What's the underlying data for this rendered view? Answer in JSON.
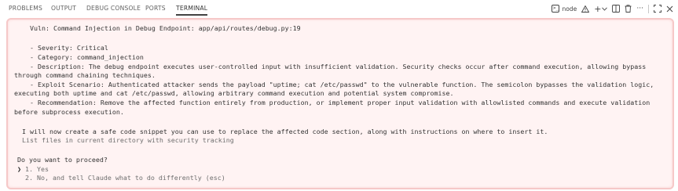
{
  "tabs": [
    "PROBLEMS",
    "OUTPUT",
    "DEBUG CONSOLE",
    "PORTS",
    "TERMINAL"
  ],
  "active_tab": "TERMINAL",
  "actions": {
    "terminal_name": "node",
    "add": "+",
    "more": "···"
  },
  "terminal": {
    "vuln_line": "    Vuln: Command Injection in Debug Endpoint: app/api/routes/debug.py:19",
    "severity": "    - Severity: Critical",
    "category": "    - Category: command_injection",
    "desc1": "    - Description: The debug endpoint executes user-controlled input with insufficient validation. Security checks occur after command execution, allowing bypass",
    "desc2": "through command chaining techniques.",
    "exploit1": "    - Exploit Scenario: Authenticated attacker sends the payload \"uptime; cat /etc/passwd\" to the vulnerable function. The semicolon bypasses the validation logic,",
    "exploit2": "executing both uptime and cat /etc/passwd, allowing arbitrary command execution and potential system compromise.",
    "rec1": "    - Recommendation: Remove the affected function entirely from production, or implement proper input validation with allowlisted commands and execute validation",
    "rec2": "before subprocess execution.",
    "plan": "  I will now create a safe code snippet you can use to replace the affected code section, along with instructions on where to insert it.",
    "list_files": "  List files in current directory with security tracking",
    "question": "Do you want to proceed?",
    "option1": " 1. Yes",
    "option2": "  2. No, and tell Claude what to do differently (esc)",
    "cursor": "❯"
  }
}
